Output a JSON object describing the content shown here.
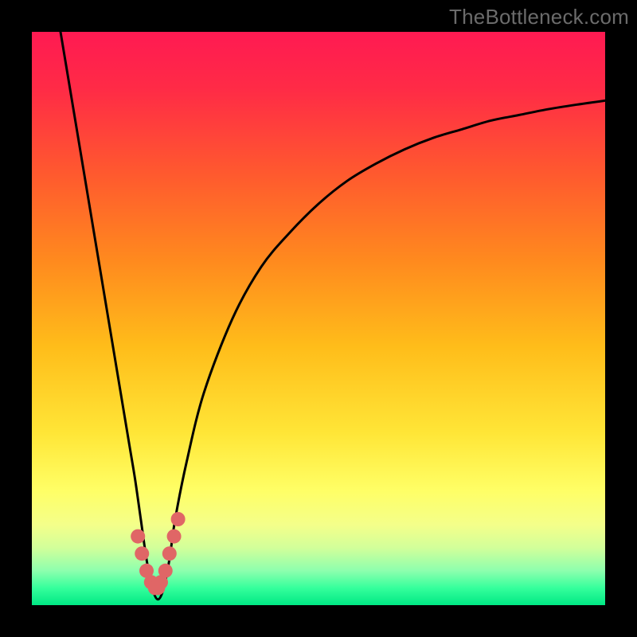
{
  "watermark": "TheBottleneck.com",
  "chart_data": {
    "type": "line",
    "title": "",
    "xlabel": "",
    "ylabel": "",
    "xlim": [
      0,
      100
    ],
    "ylim": [
      0,
      100
    ],
    "grid": false,
    "legend": false,
    "background_gradient_stops": [
      {
        "pos": 0.0,
        "color": "#ff1a52"
      },
      {
        "pos": 0.1,
        "color": "#ff2b46"
      },
      {
        "pos": 0.25,
        "color": "#ff5a2e"
      },
      {
        "pos": 0.4,
        "color": "#ff8a1e"
      },
      {
        "pos": 0.55,
        "color": "#ffbd1a"
      },
      {
        "pos": 0.7,
        "color": "#ffe637"
      },
      {
        "pos": 0.8,
        "color": "#ffff66"
      },
      {
        "pos": 0.86,
        "color": "#f4ff8a"
      },
      {
        "pos": 0.9,
        "color": "#d2ff9a"
      },
      {
        "pos": 0.94,
        "color": "#8dffae"
      },
      {
        "pos": 0.97,
        "color": "#35ff9c"
      },
      {
        "pos": 1.0,
        "color": "#00e884"
      }
    ],
    "series": [
      {
        "name": "bottleneck-curve",
        "color": "#000000",
        "x": [
          5,
          7,
          9,
          11,
          13,
          15,
          17,
          18,
          19,
          20,
          21,
          22,
          23,
          24,
          25,
          27,
          30,
          35,
          40,
          45,
          50,
          55,
          60,
          65,
          70,
          75,
          80,
          85,
          90,
          95,
          100
        ],
        "y": [
          100,
          88,
          76,
          64,
          52,
          40,
          28,
          22,
          15,
          8,
          3,
          1,
          3,
          8,
          15,
          25,
          37,
          50,
          59,
          65,
          70,
          74,
          77,
          79.5,
          81.5,
          83,
          84.5,
          85.5,
          86.5,
          87.3,
          88
        ]
      },
      {
        "name": "trough-marker",
        "color": "#e06666",
        "style": "dots",
        "x": [
          18.5,
          19.2,
          20.0,
          20.8,
          21.5,
          22.0,
          22.5,
          23.3,
          24.0,
          24.8,
          25.5
        ],
        "y": [
          12,
          9,
          6,
          4,
          3,
          3,
          4,
          6,
          9,
          12,
          15
        ]
      }
    ]
  }
}
